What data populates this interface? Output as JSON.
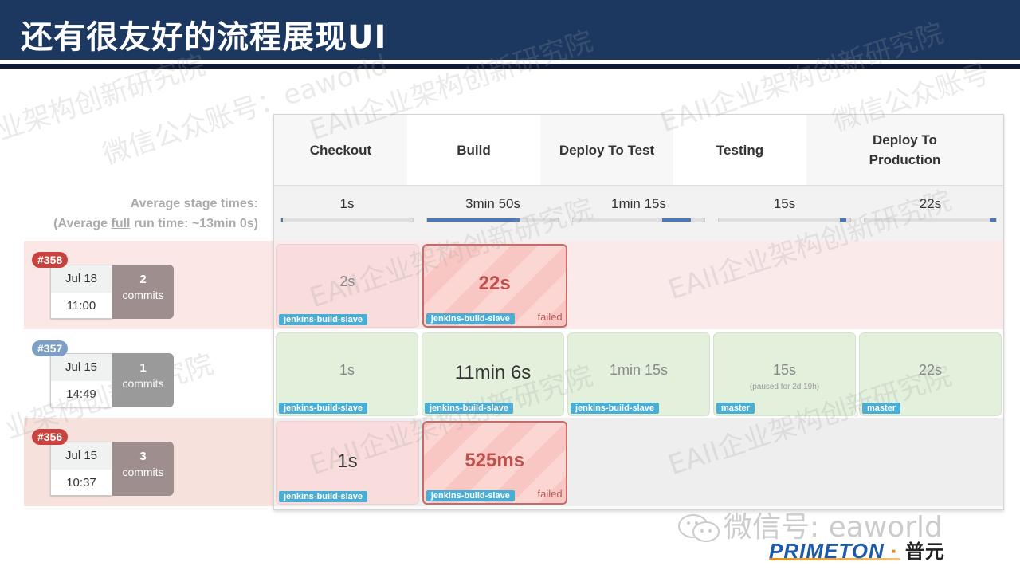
{
  "slide": {
    "title": "还有很友好的流程展现UI"
  },
  "pipeline": {
    "stages": [
      {
        "name": "Checkout",
        "avg_time": "1s",
        "avg_bar_start": 0.0,
        "avg_bar_end": 0.01
      },
      {
        "name": "Build",
        "avg_time": "3min 50s",
        "avg_bar_start": 0.0,
        "avg_bar_end": 0.7
      },
      {
        "name": "Deploy To Test",
        "avg_time": "1min 15s",
        "avg_bar_start": 0.68,
        "avg_bar_end": 0.9
      },
      {
        "name": "Testing",
        "avg_time": "15s",
        "avg_bar_start": 0.92,
        "avg_bar_end": 0.97
      },
      {
        "name": "Deploy To Production",
        "avg_time": "22s",
        "avg_bar_start": 0.95,
        "avg_bar_end": 1.0
      }
    ],
    "avg_label_line1": "Average stage times:",
    "avg_label_line2_pre": "(Average ",
    "avg_label_link": "full",
    "avg_label_line2_post": " run time: ~13min 0s)",
    "runs": [
      {
        "id": "#358",
        "status": "failed",
        "badge_color": "#c9423f",
        "date": "Jul 18",
        "time": "11:00",
        "commit_count": "2",
        "commit_label": "commits",
        "commit_color": "#9e8f8e",
        "cells": [
          {
            "state": "fail-pre",
            "time": "2s",
            "node": "jenkins-build-slave"
          },
          {
            "state": "failed",
            "time": "22s",
            "node": "jenkins-build-slave",
            "failed_label": "failed"
          },
          {
            "state": "empty"
          },
          {
            "state": "empty"
          },
          {
            "state": "empty"
          }
        ]
      },
      {
        "id": "#357",
        "status": "success",
        "badge_color": "#7e9fc5",
        "date": "Jul 15",
        "time": "14:49",
        "commit_count": "1",
        "commit_label": "commits",
        "commit_color": "#9a9a9a",
        "cells": [
          {
            "state": "ok",
            "time": "1s",
            "node": "jenkins-build-slave"
          },
          {
            "state": "ok",
            "time": "11min 6s",
            "node": "jenkins-build-slave",
            "big": true
          },
          {
            "state": "ok",
            "time": "1min 15s",
            "node": "jenkins-build-slave"
          },
          {
            "state": "ok",
            "time": "15s",
            "sub": "(paused for 2d 19h)",
            "node": "master"
          },
          {
            "state": "ok",
            "time": "22s",
            "node": "master"
          }
        ]
      },
      {
        "id": "#356",
        "status": "failed",
        "badge_color": "#c9423f",
        "date": "Jul 15",
        "time": "10:37",
        "commit_count": "3",
        "commit_label": "commits",
        "commit_color": "#9e8f8e",
        "cells": [
          {
            "state": "fail-pre",
            "time": "1s",
            "node": "jenkins-build-slave",
            "big": true
          },
          {
            "state": "failed",
            "time": "525ms",
            "node": "jenkins-build-slave",
            "failed_label": "failed"
          },
          {
            "state": "empty"
          },
          {
            "state": "empty"
          },
          {
            "state": "empty"
          }
        ]
      }
    ]
  },
  "footer": {
    "wechat_icon": "wechat-icon",
    "wechat_text": "微信号: eaworld",
    "brand_text": "PRIMETON",
    "brand_dot": "·",
    "brand_cn": "普元"
  },
  "watermarks": [
    "业架构创新研究院",
    "微信公众账号：eaworld",
    "EAII企业架构创新研究院",
    "微信公众账号"
  ]
}
